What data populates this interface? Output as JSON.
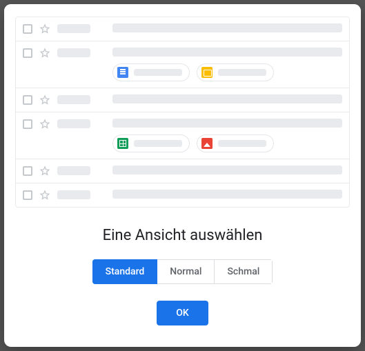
{
  "title": "Eine Ansicht auswählen",
  "options": {
    "standard": "Standard",
    "normal": "Normal",
    "schmal": "Schmal"
  },
  "ok_label": "OK",
  "chip_icons": {
    "docs": "docs-icon",
    "slides": "slides-icon",
    "sheets": "sheets-icon",
    "image": "image-icon"
  }
}
